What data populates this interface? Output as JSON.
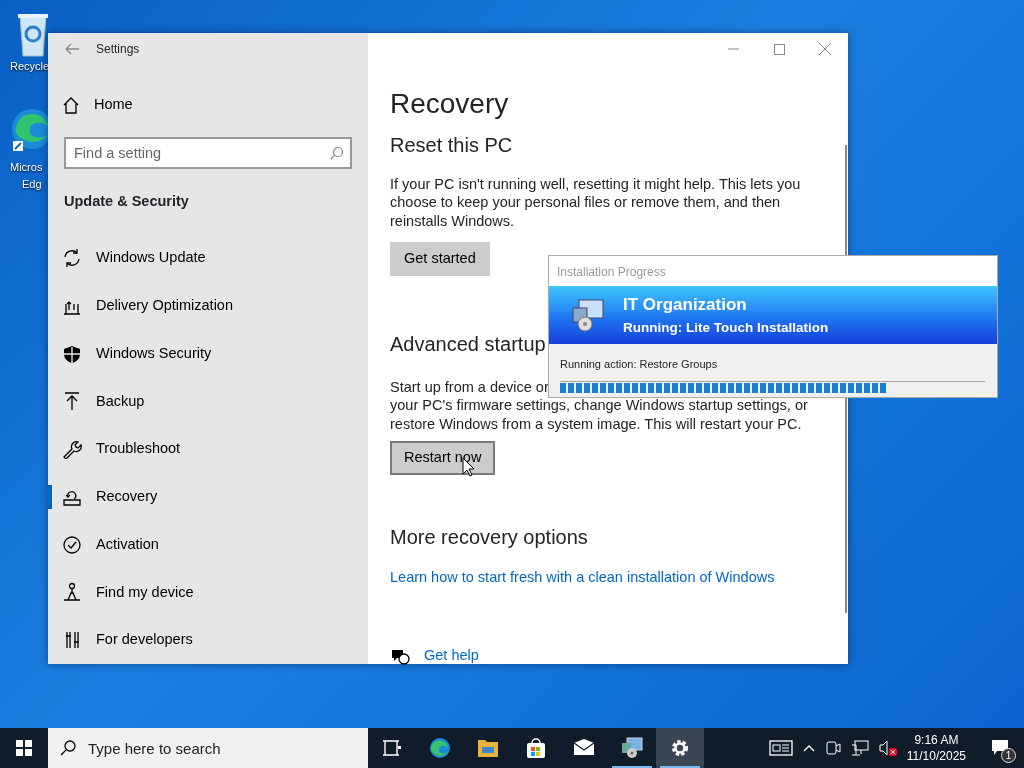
{
  "desktop_icons": [
    {
      "kind": "recycle",
      "lines": [
        "Recycle"
      ]
    },
    {
      "kind": "edge",
      "lines": [
        "Micros",
        "Edg"
      ]
    }
  ],
  "window": {
    "title": "Settings",
    "home": "Home",
    "search": {
      "placeholder": "Find a setting"
    },
    "section": "Update & Security",
    "sidebar": {
      "items": [
        {
          "kind": "update",
          "label": "Windows Update",
          "selected": false
        },
        {
          "kind": "delivery",
          "label": "Delivery Optimization",
          "selected": false
        },
        {
          "kind": "shield",
          "label": "Windows Security",
          "selected": false
        },
        {
          "kind": "backup",
          "label": "Backup",
          "selected": false
        },
        {
          "kind": "wrench",
          "label": "Troubleshoot",
          "selected": false
        },
        {
          "kind": "recovery",
          "label": "Recovery",
          "selected": true
        },
        {
          "kind": "check",
          "label": "Activation",
          "selected": false
        },
        {
          "kind": "person",
          "label": "Find my device",
          "selected": false
        },
        {
          "kind": "dev",
          "label": "For developers",
          "selected": false
        }
      ]
    },
    "page_title": "Recovery",
    "reset": {
      "heading": "Reset this PC",
      "text": "If your PC isn't running well, resetting it might help. This lets you choose to keep your personal files or remove them, and then reinstalls Windows.",
      "button": "Get started"
    },
    "advanced": {
      "heading": "Advanced startup",
      "lines": [
        "Start up from a device or",
        "your PC's firmware settings, change Windows startup settings, or",
        "restore Windows from a system image. This will restart your PC."
      ],
      "button": "Restart now"
    },
    "more": {
      "heading": "More recovery options",
      "link": "Learn how to start fresh with a clean installation of Windows"
    },
    "help": "Get help"
  },
  "progress_window": {
    "title": "Installation Progress",
    "organization": "IT Organization",
    "status": "Running: Lite Touch Installation",
    "action": "Running action: Restore Groups",
    "level": 0.77
  },
  "taskbar": {
    "search": {
      "placeholder": "Type here to search"
    },
    "apps": [
      {
        "kind": "taskview",
        "running": false,
        "selected": false
      },
      {
        "kind": "edge",
        "running": false,
        "selected": false
      },
      {
        "kind": "folder",
        "running": false,
        "selected": false
      },
      {
        "kind": "store",
        "running": false,
        "selected": false
      },
      {
        "kind": "mail",
        "running": false,
        "selected": false
      },
      {
        "kind": "deploy",
        "running": true,
        "selected": false
      },
      {
        "kind": "gear",
        "running": true,
        "selected": true
      }
    ],
    "time": "9:16 AM",
    "date": "11/10/2025",
    "notifications": "1"
  }
}
